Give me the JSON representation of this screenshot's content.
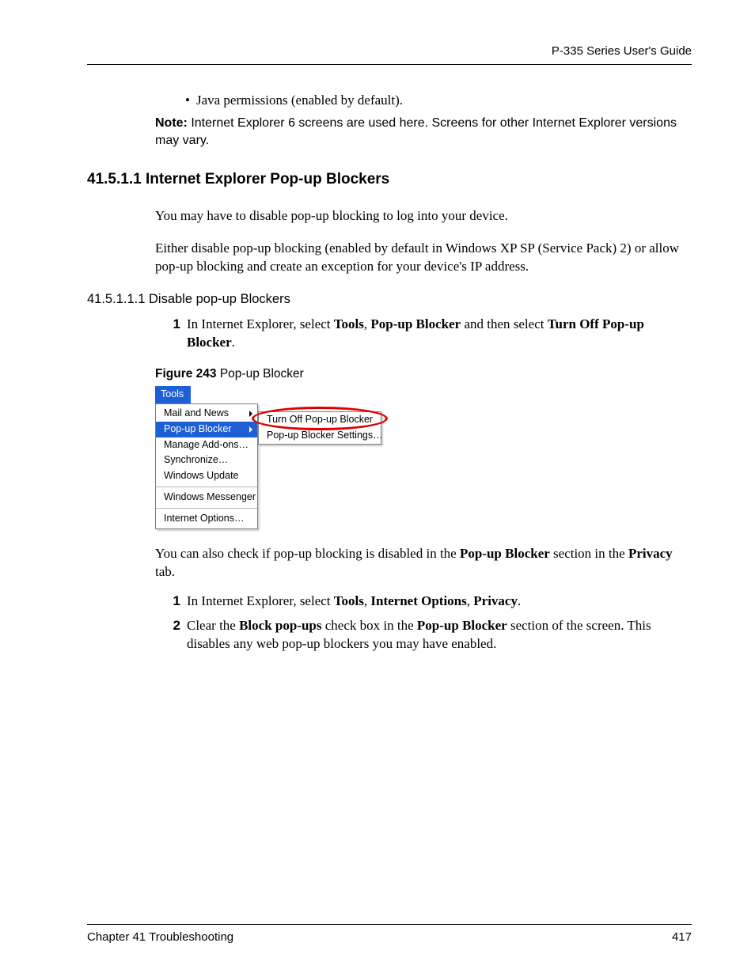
{
  "header": {
    "guide_title": "P-335 Series User's Guide"
  },
  "bullet": {
    "dot": "•",
    "text": "Java permissions (enabled by default)."
  },
  "note": {
    "label": "Note:",
    "text": " Internet Explorer 6 screens are used here. Screens for other Internet Explorer versions may vary."
  },
  "s41511": {
    "num": "41.5.1.1",
    "title": "  Internet Explorer Pop-up Blockers",
    "p1": "You may have to disable pop-up blocking to log into your device.",
    "p2": "Either disable pop-up blocking (enabled by default in Windows XP SP (Service Pack) 2) or allow pop-up blocking and create an exception for your device's IP address."
  },
  "s415111": {
    "num": "41.5.1.1.1",
    "title": "  Disable pop-up Blockers",
    "step1_num": "1",
    "step1_a": "In Internet Explorer, select ",
    "step1_b": "Tools",
    "step1_c": ", ",
    "step1_d": "Pop-up Blocker",
    "step1_e": " and then select ",
    "step1_f": "Turn Off Pop-up Blocker",
    "step1_g": "."
  },
  "figure": {
    "label": "Figure 243",
    "caption": "   Pop-up Blocker",
    "tools_btn": "Tools",
    "menu": {
      "mail_news": "Mail and News",
      "popup_blocker": "Pop-up Blocker",
      "manage_addons": "Manage Add-ons…",
      "synchronize": "Synchronize…",
      "windows_update": "Windows Update",
      "windows_messenger": "Windows Messenger",
      "internet_options": "Internet Options…"
    },
    "submenu": {
      "turn_off": "Turn Off Pop-up Blocker",
      "settings": "Pop-up Blocker Settings…"
    }
  },
  "after_fig": {
    "p_a": "You can also check if pop-up blocking is disabled in the ",
    "p_b": "Pop-up Blocker",
    "p_c": " section in the ",
    "p_d": "Privacy",
    "p_e": " tab.",
    "step1_num": "1",
    "step1_a": "In Internet Explorer, select ",
    "step1_b": "Tools",
    "step1_c": ", ",
    "step1_d": "Internet Options",
    "step1_e": ", ",
    "step1_f": "Privacy",
    "step1_g": ".",
    "step2_num": "2",
    "step2_a": "Clear the ",
    "step2_b": "Block pop-ups",
    "step2_c": " check box in the ",
    "step2_d": "Pop-up Blocker",
    "step2_e": " section of the screen. This disables any web pop-up blockers you may have enabled."
  },
  "footer": {
    "chapter": "Chapter 41 Troubleshooting",
    "page": "417"
  }
}
